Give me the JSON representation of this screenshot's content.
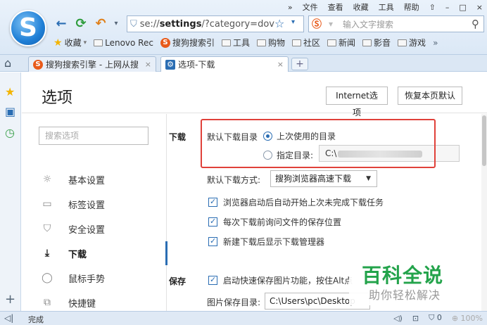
{
  "menubar": {
    "expand": "»",
    "items": [
      "文件",
      "查看",
      "收藏",
      "工具",
      "帮助"
    ],
    "skin": "⇧",
    "minimize": "–",
    "maximize": "□",
    "close": "×"
  },
  "toolbar": {
    "back": "←",
    "refresh": "⟳",
    "undo": "↶",
    "undo_drop": "▾"
  },
  "address": {
    "prefix": "se://",
    "bold": "settings",
    "rest": "/?category=dov"
  },
  "search": {
    "placeholder": "输入文字搜索"
  },
  "bookmarks": [
    {
      "label": "收藏",
      "icon": "star-icon"
    },
    {
      "label": "Lenovo Rec",
      "icon": "folder-icon"
    },
    {
      "label": "搜狗搜索引",
      "icon": "sogou-icon"
    },
    {
      "label": "工具",
      "icon": "folder-icon"
    },
    {
      "label": "购物",
      "icon": "folder-icon"
    },
    {
      "label": "社区",
      "icon": "folder-icon"
    },
    {
      "label": "新闻",
      "icon": "folder-icon"
    },
    {
      "label": "影音",
      "icon": "folder-icon"
    },
    {
      "label": "游戏",
      "icon": "folder-icon"
    }
  ],
  "bookmarks_more": "»",
  "tabs": [
    {
      "label": "搜狗搜索引擎 - 上网从搜",
      "close": "×"
    },
    {
      "label": "选项-下载",
      "close": "×"
    }
  ],
  "new_tab": "+",
  "page": {
    "title": "选项",
    "internet_button": "Internet选项",
    "restore_button": "恢复本页默认",
    "search_placeholder": "搜索选项"
  },
  "nav": [
    {
      "label": "基本设置",
      "icon": "gear-icon",
      "glyph": "☼"
    },
    {
      "label": "标签设置",
      "icon": "tab-icon",
      "glyph": "▭"
    },
    {
      "label": "安全设置",
      "icon": "shield-icon",
      "glyph": "⛉"
    },
    {
      "label": "下载",
      "icon": "download-icon",
      "glyph": "⤓"
    },
    {
      "label": "鼠标手势",
      "icon": "mouse-icon",
      "glyph": "◯"
    },
    {
      "label": "快捷键",
      "icon": "shortcut-icon",
      "glyph": "⧉"
    }
  ],
  "download": {
    "section": "下载",
    "dir_label": "默认下载目录",
    "last_used": "上次使用的目录",
    "specified": "指定目录:",
    "dir_value": "C:\\",
    "method_label": "默认下载方式:",
    "method_value": "搜狗浏览器高速下载",
    "opt1": "浏览器启动后自动开始上次未完成下载任务",
    "opt2": "每次下载前询问文件的保存位置",
    "opt3": "新建下载后显示下载管理器"
  },
  "save": {
    "section": "保存",
    "opt1": "启动快速保存图片功能，按住Alt点",
    "path_label": "图片保存目录:",
    "path_value": "C:\\Users\\pc\\Desktop"
  },
  "watermark": {
    "big": "百科全说",
    "small": "助你轻松解决"
  },
  "status": {
    "text": "完成",
    "counter": "0",
    "zoom": "100%"
  }
}
